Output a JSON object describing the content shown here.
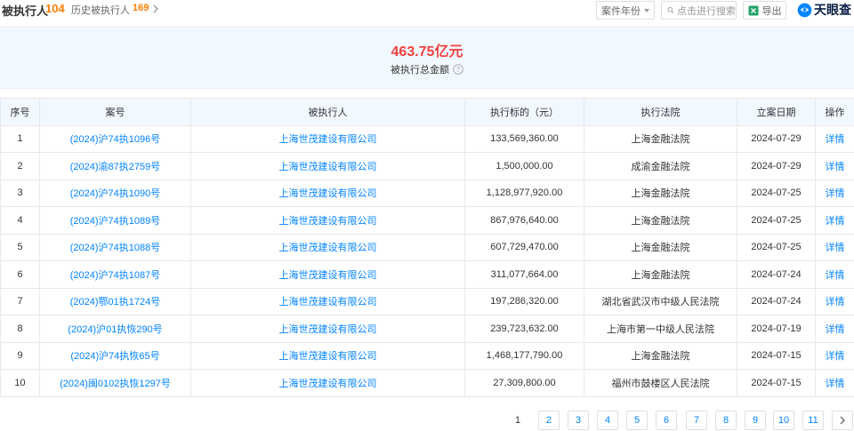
{
  "header": {
    "title": "被执行人",
    "count": "104",
    "history_label": "历史被执行人",
    "history_count": "169",
    "year_filter": "案件年份",
    "search_placeholder": "点击进行搜索",
    "export_label": "导出",
    "brand": "天眼查"
  },
  "summary": {
    "amount": "463.75亿元",
    "label": "被执行总金额"
  },
  "table": {
    "columns": [
      "序号",
      "案号",
      "被执行人",
      "执行标的（元）",
      "执行法院",
      "立案日期",
      "操作"
    ],
    "rows": [
      {
        "no": "1",
        "case": "(2024)沪74执1096号",
        "party": "上海世茂建设有限公司",
        "amount": "133,569,360.00",
        "court": "上海金融法院",
        "date": "2024-07-29",
        "op": "详情"
      },
      {
        "no": "2",
        "case": "(2024)渝87执2759号",
        "party": "上海世茂建设有限公司",
        "amount": "1,500,000.00",
        "court": "成渝金融法院",
        "date": "2024-07-29",
        "op": "详情"
      },
      {
        "no": "3",
        "case": "(2024)沪74执1090号",
        "party": "上海世茂建设有限公司",
        "amount": "1,128,977,920.00",
        "court": "上海金融法院",
        "date": "2024-07-25",
        "op": "详情"
      },
      {
        "no": "4",
        "case": "(2024)沪74执1089号",
        "party": "上海世茂建设有限公司",
        "amount": "867,976,640.00",
        "court": "上海金融法院",
        "date": "2024-07-25",
        "op": "详情"
      },
      {
        "no": "5",
        "case": "(2024)沪74执1088号",
        "party": "上海世茂建设有限公司",
        "amount": "607,729,470.00",
        "court": "上海金融法院",
        "date": "2024-07-25",
        "op": "详情"
      },
      {
        "no": "6",
        "case": "(2024)沪74执1087号",
        "party": "上海世茂建设有限公司",
        "amount": "311,077,664.00",
        "court": "上海金融法院",
        "date": "2024-07-24",
        "op": "详情"
      },
      {
        "no": "7",
        "case": "(2024)鄂01执1724号",
        "party": "上海世茂建设有限公司",
        "amount": "197,286,320.00",
        "court": "湖北省武汉市中级人民法院",
        "date": "2024-07-24",
        "op": "详情"
      },
      {
        "no": "8",
        "case": "(2024)沪01执恢290号",
        "party": "上海世茂建设有限公司",
        "amount": "239,723,632.00",
        "court": "上海市第一中级人民法院",
        "date": "2024-07-19",
        "op": "详情"
      },
      {
        "no": "9",
        "case": "(2024)沪74执恢65号",
        "party": "上海世茂建设有限公司",
        "amount": "1,468,177,790.00",
        "court": "上海金融法院",
        "date": "2024-07-15",
        "op": "详情"
      },
      {
        "no": "10",
        "case": "(2024)闽0102执恢1297号",
        "party": "上海世茂建设有限公司",
        "amount": "27,309,800.00",
        "court": "福州市鼓楼区人民法院",
        "date": "2024-07-15",
        "op": "详情"
      }
    ]
  },
  "pagination": {
    "pages": [
      "1",
      "2",
      "3",
      "4",
      "5",
      "6",
      "7",
      "8",
      "9",
      "10",
      "11"
    ],
    "current": "1",
    "next_icon": "chevron-right-icon"
  },
  "colors": {
    "accent": "#0084ff",
    "count": "#ff7d00",
    "amount": "#f04040",
    "header_bg": "#f2f8ff"
  }
}
